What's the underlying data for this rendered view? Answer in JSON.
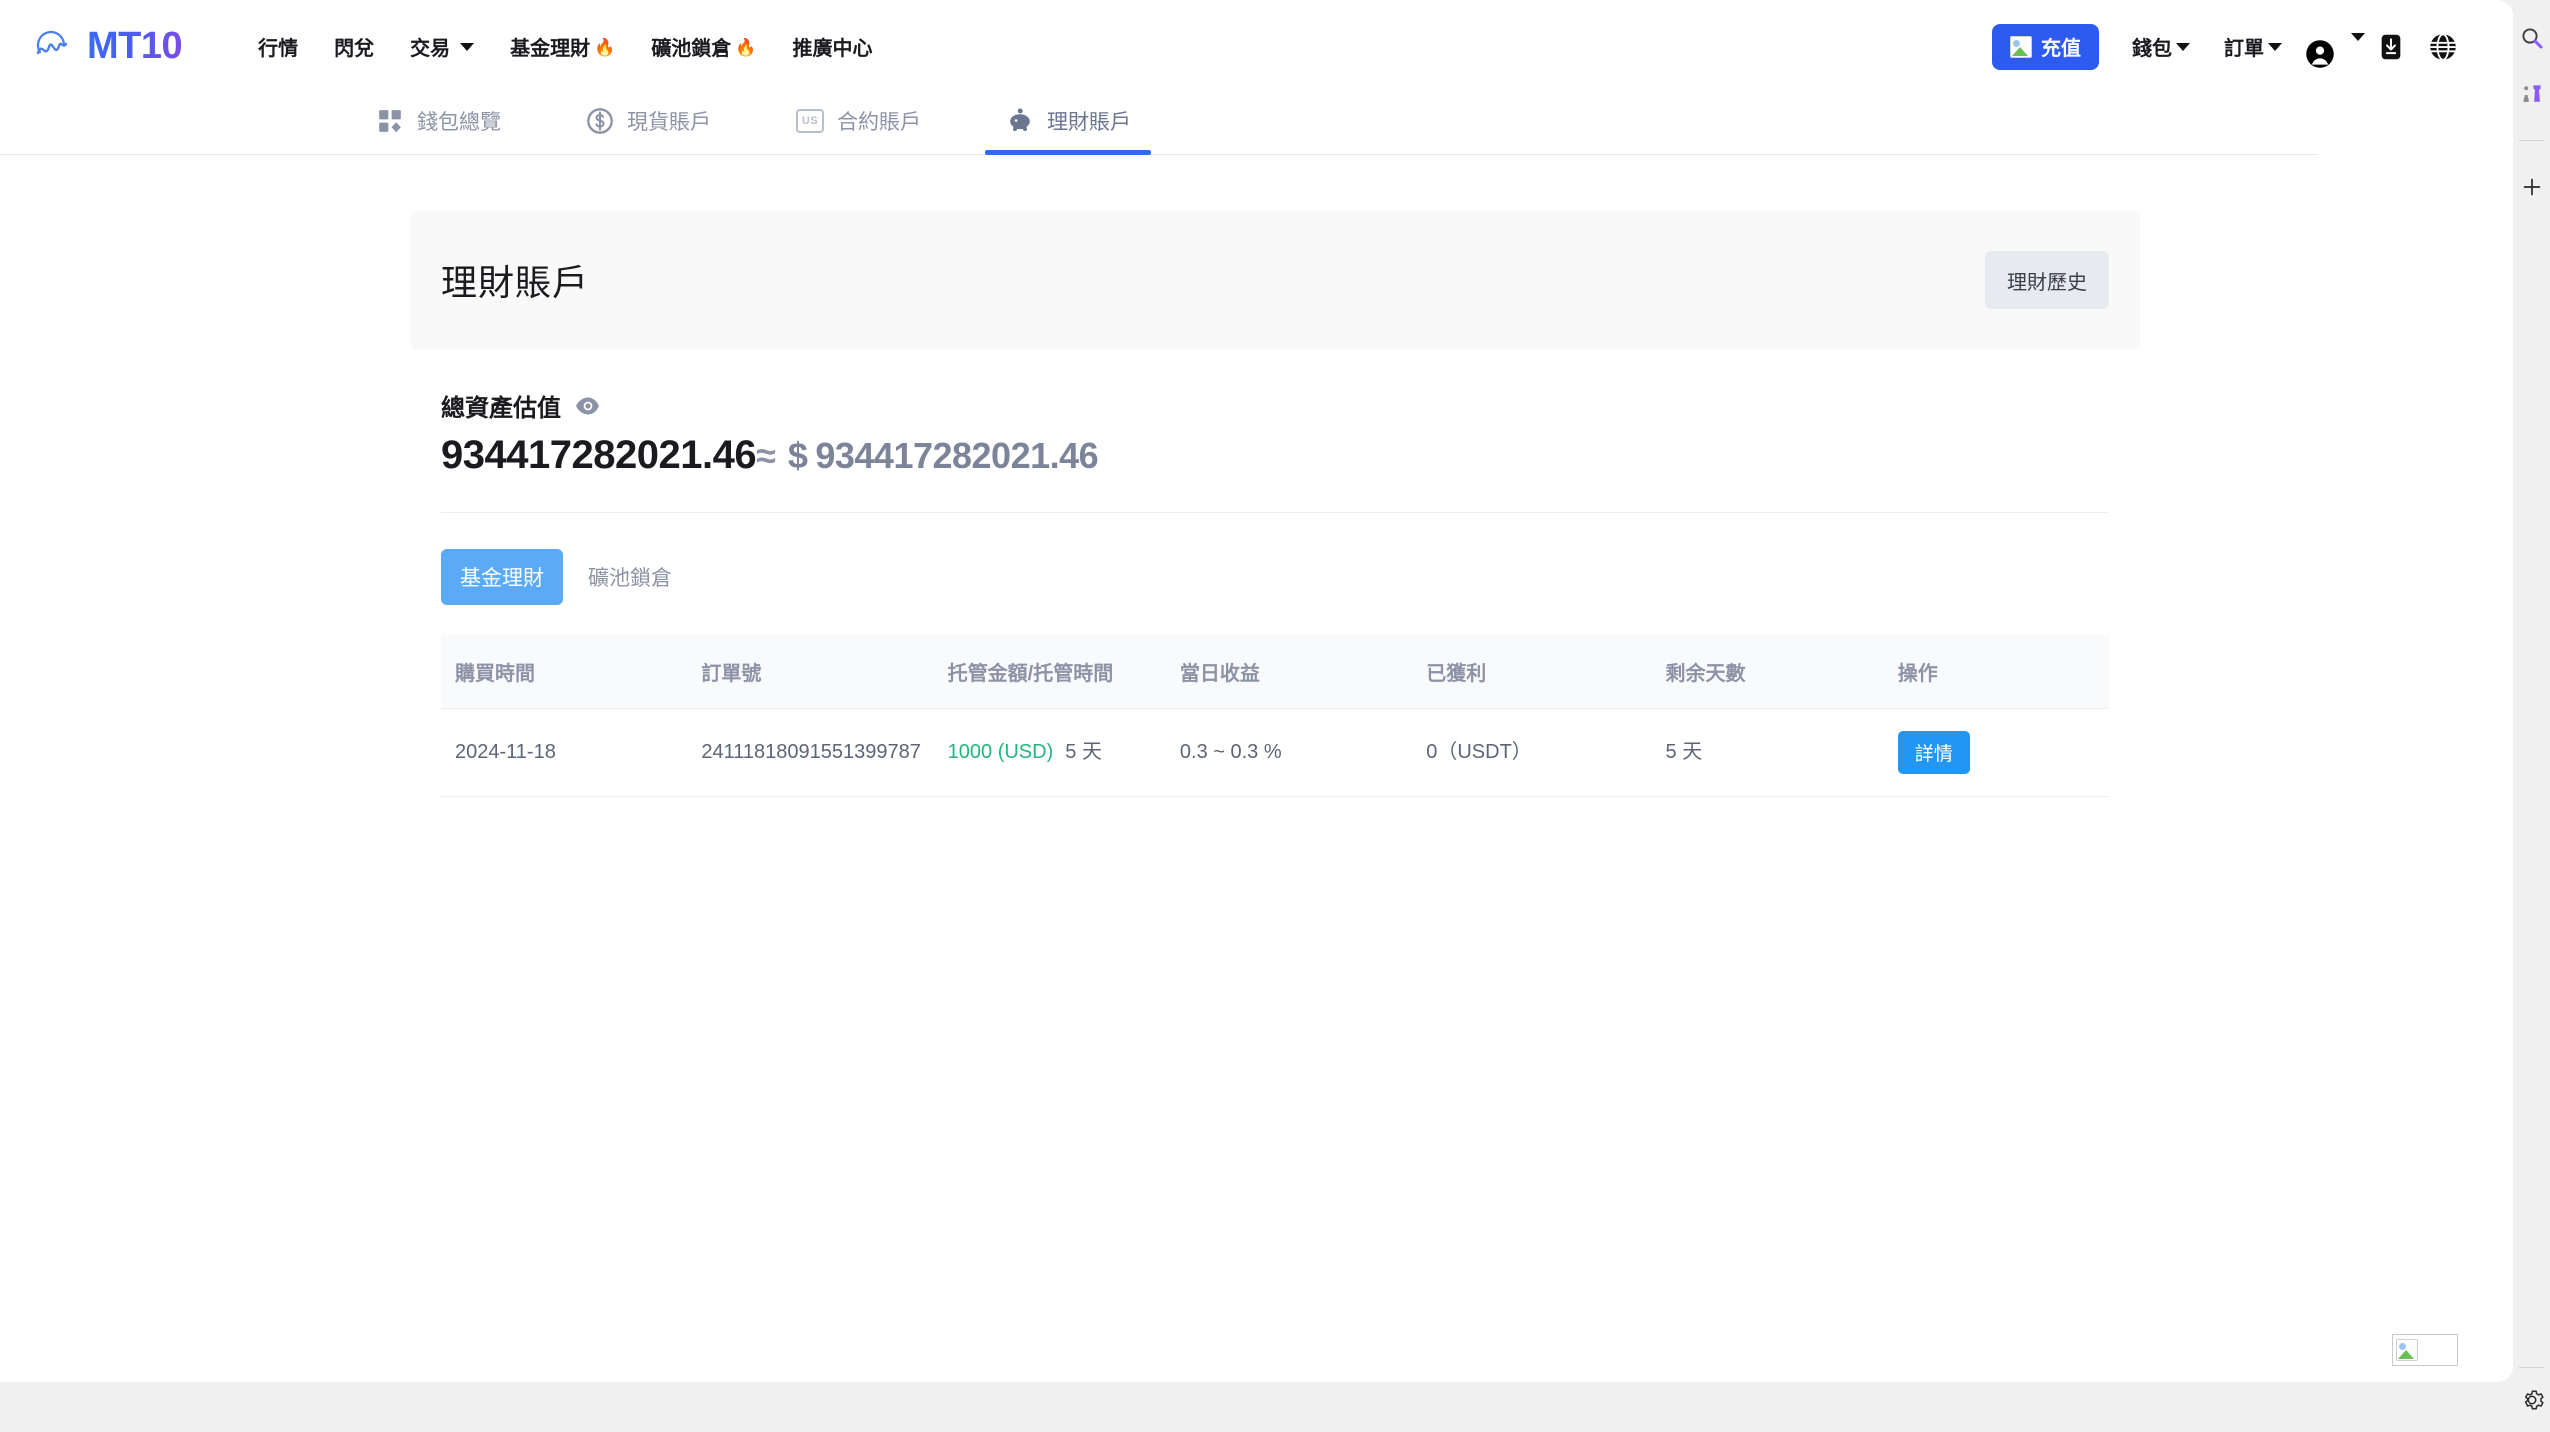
{
  "brand": {
    "name": "MT10",
    "logo_icon": "wave-circle-logo"
  },
  "main_nav": [
    {
      "label": "行情",
      "has_caret": false,
      "flame": false
    },
    {
      "label": "閃兌",
      "has_caret": false,
      "flame": false
    },
    {
      "label": "交易",
      "has_caret": true,
      "flame": false
    },
    {
      "label": "基金理財",
      "has_caret": false,
      "flame": true
    },
    {
      "label": "礦池鎖倉",
      "has_caret": false,
      "flame": true
    },
    {
      "label": "推廣中心",
      "has_caret": false,
      "flame": false
    }
  ],
  "header_right": {
    "recharge_label": "充值",
    "recharge_icon": "broken-image-icon",
    "wallet_label": "錢包",
    "orders_label": "訂單",
    "avatar_icon": "user-avatar-icon",
    "download_icon": "download-icon",
    "language_icon": "globe-icon",
    "accent_color": "#2d5bf0"
  },
  "account_tabs": [
    {
      "label": "錢包總覽",
      "icon": "grid-squares-icon",
      "active": false
    },
    {
      "label": "現貨賬戶",
      "icon": "dollar-circle-icon",
      "active": false
    },
    {
      "label": "合約賬戶",
      "icon": "us-box-icon",
      "active": false
    },
    {
      "label": "理財賬戶",
      "icon": "piggy-bank-icon",
      "active": true
    }
  ],
  "page": {
    "title": "理財賬戶",
    "history_button": "理財歷史"
  },
  "assets": {
    "label": "總資產估值",
    "eye_icon": "eye-icon",
    "primary_value": "934417282021.46",
    "approx_symbol": "≈",
    "currency_symbol": "$",
    "secondary_value": "934417282021.46"
  },
  "subtabs": [
    {
      "label": "基金理財",
      "active": true
    },
    {
      "label": "礦池鎖倉",
      "active": false
    }
  ],
  "table": {
    "headers": [
      "購買時間",
      "訂單號",
      "托管金額/托管時間",
      "當日收益",
      "已獲利",
      "剩余天數",
      "操作"
    ],
    "rows": [
      {
        "purchase_time": "2024-11-18",
        "order_no": "24111818091551399787",
        "amount": "1000 (USD)",
        "duration": "5 天",
        "daily_yield": "0.3 ~ 0.3 %",
        "profit": "0（USDT）",
        "days_left": "5 天",
        "action_label": "詳情"
      }
    ],
    "amount_color": "#24b47e",
    "action_color": "#2196f3"
  },
  "right_rail": {
    "search_icon": "search-icon",
    "collections_icon": "chess-pieces-icon",
    "add_icon": "plus-icon",
    "settings_icon": "gear-icon"
  },
  "bottom_overlay": {
    "icon": "broken-image-icon"
  }
}
